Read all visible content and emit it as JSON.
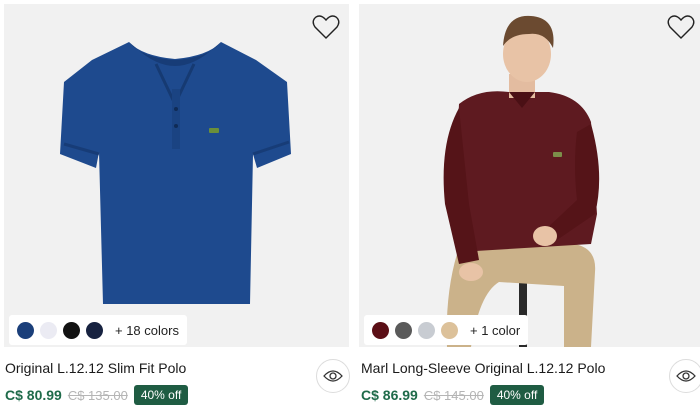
{
  "products": [
    {
      "title": "Original L.12.12 Slim Fit Polo",
      "price": "C$ 80.99",
      "old_price": "C$ 135.00",
      "discount": "40% off",
      "more_colors": "+ 18 colors",
      "swatch_colors": [
        "#1b3f7a",
        "#ebebf3",
        "#121212",
        "#172240"
      ],
      "garment_color": "#1e4a8e",
      "icon": "polo-shirt-image"
    },
    {
      "title": "Marl Long-Sleeve Original L.12.12 Polo",
      "price": "C$ 86.99",
      "old_price": "C$ 145.00",
      "discount": "40% off",
      "more_colors": "+ 1 color",
      "swatch_colors": [
        "#5b0f16",
        "#5a5a5a",
        "#c8ccd2",
        "#dcc19a"
      ],
      "garment_color": "#5e1a20",
      "icon": "model-photo-image"
    }
  ],
  "icons": {
    "wishlist": "heart-icon",
    "quick_view": "eye-icon"
  }
}
